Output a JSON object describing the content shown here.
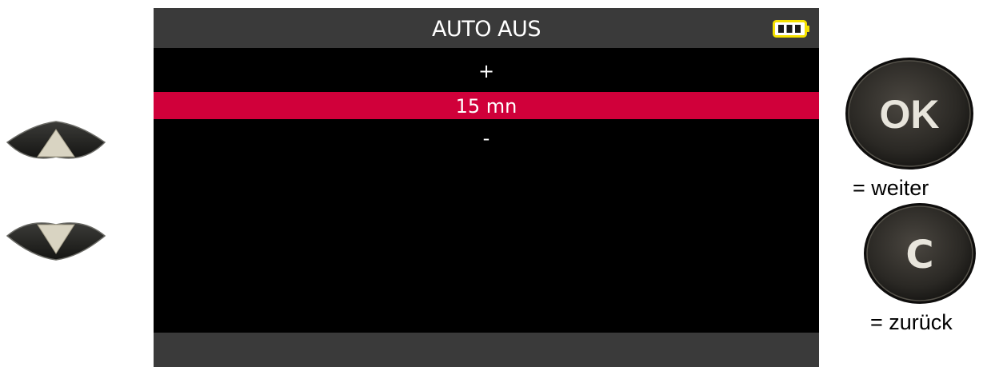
{
  "screen": {
    "title": "AUTO AUS",
    "battery_icon": "battery-full-icon",
    "menu": {
      "plus_label": "+",
      "selected_value": "15 mn",
      "minus_label": "-"
    }
  },
  "keys": {
    "up_icon": "arrow-up-key",
    "down_icon": "arrow-down-key",
    "ok_label": "OK",
    "ok_hint": "= weiter",
    "c_label": "C",
    "c_hint": "= zurück"
  },
  "colors": {
    "selection": "#d0003a",
    "header_bar": "#3a3a3a",
    "battery": "#f5e100"
  }
}
